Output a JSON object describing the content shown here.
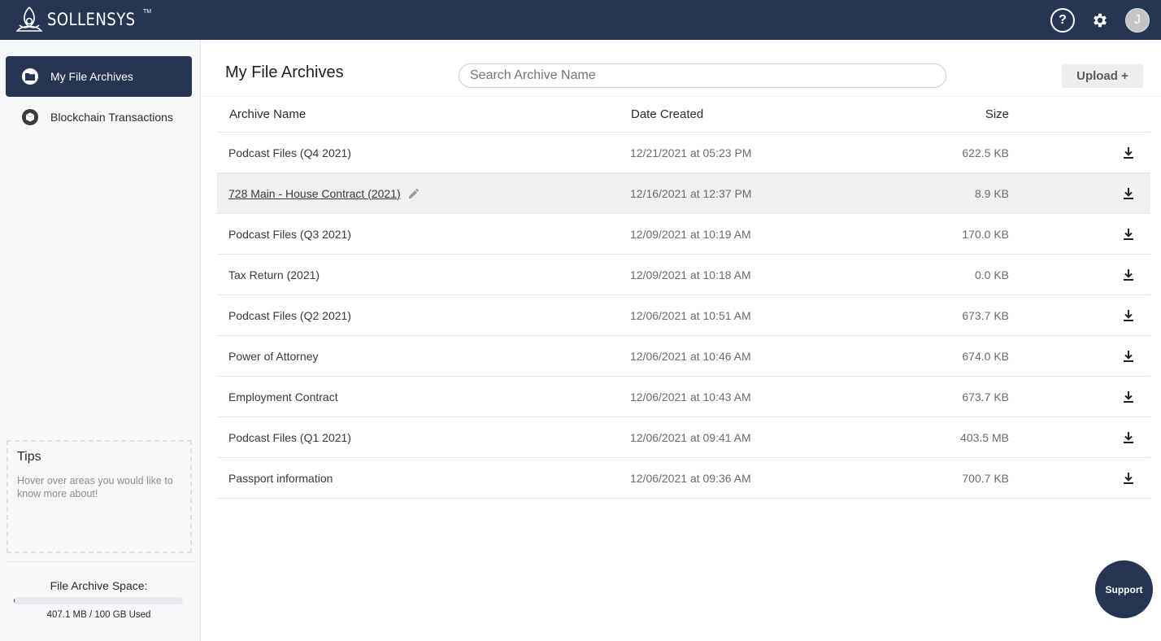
{
  "brand": {
    "name": "SOLLENSYS",
    "tm": "TM"
  },
  "topbar": {
    "help_label": "?",
    "avatar_initial": "J"
  },
  "sidebar": {
    "items": [
      {
        "label": "My File Archives",
        "icon": "folder-icon",
        "active": true
      },
      {
        "label": "Blockchain Transactions",
        "icon": "cube-icon",
        "active": false
      }
    ],
    "tips": {
      "title": "Tips",
      "text": "Hover over areas you would like to know more about!"
    },
    "storage": {
      "title": "File Archive Space:",
      "used_text": "407.1 MB / 100 GB Used",
      "used_fraction": 0.004
    }
  },
  "main": {
    "title": "My File Archives",
    "search_placeholder": "Search Archive Name",
    "upload_label": "Upload +",
    "columns": {
      "name": "Archive Name",
      "date": "Date Created",
      "size": "Size"
    },
    "rows": [
      {
        "name": "Podcast Files (Q4 2021)",
        "date": "12/21/2021 at 05:23 PM",
        "size": "622.5 KB"
      },
      {
        "name": "728 Main - House Contract (2021)",
        "date": "12/16/2021 at 12:37 PM",
        "size": "8.9 KB"
      },
      {
        "name": "Podcast Files (Q3 2021)",
        "date": "12/09/2021 at 10:19 AM",
        "size": "170.0 KB"
      },
      {
        "name": "Tax Return (2021)",
        "date": "12/09/2021 at 10:18 AM",
        "size": "0.0 KB"
      },
      {
        "name": "Podcast Files (Q2 2021)",
        "date": "12/06/2021 at 10:51 AM",
        "size": "673.7 KB"
      },
      {
        "name": "Power of Attorney",
        "date": "12/06/2021 at 10:46 AM",
        "size": "674.0 KB"
      },
      {
        "name": "Employment Contract",
        "date": "12/06/2021 at 10:43 AM",
        "size": "673.7 KB"
      },
      {
        "name": "Podcast Files (Q1 2021)",
        "date": "12/06/2021 at 09:41 AM",
        "size": "403.5 MB"
      },
      {
        "name": "Passport information",
        "date": "12/06/2021 at 09:36 AM",
        "size": "700.7 KB"
      }
    ]
  },
  "support_label": "Support",
  "colors": {
    "navy": "#263552",
    "row_hover": "#f0f0f0"
  }
}
